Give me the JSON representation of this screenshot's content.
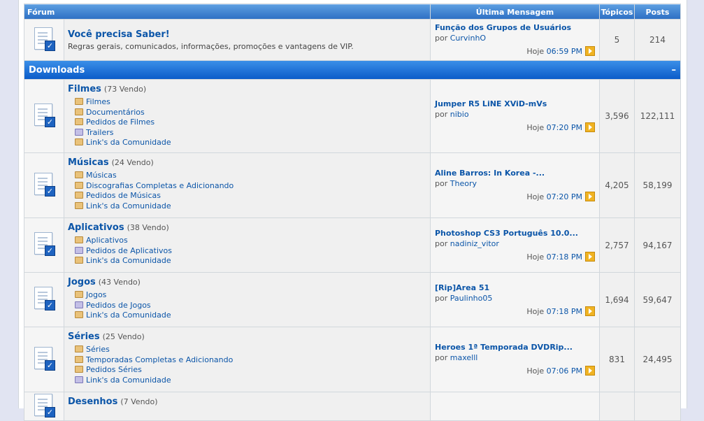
{
  "header": {
    "forum": "Fórum",
    "last_post": "Última Mensagem",
    "threads": "Tópicos",
    "posts": "Posts"
  },
  "top_forum": {
    "title": "Você precisa Saber!",
    "description": "Regras gerais, comunicados, informações, promoções e vantagens de VIP.",
    "last_post": {
      "title": "Função dos Grupos de Usuários",
      "by": "por",
      "user": "CurvinhO",
      "day": "Hoje",
      "time": "06:59 PM"
    },
    "threads": "5",
    "posts": "214"
  },
  "category": {
    "title": "Downloads",
    "collapse": "–"
  },
  "forums": [
    {
      "title": "Filmes",
      "viewing": "(73 Vendo)",
      "subforums": [
        {
          "label": "Filmes",
          "icon": "folder-icon"
        },
        {
          "label": "Documentários",
          "icon": "folder-icon"
        },
        {
          "label": "Pedidos de Filmes",
          "icon": "folder-icon"
        },
        {
          "label": "Trailers",
          "icon": "folder-purple-icon"
        },
        {
          "label": "Link's da Comunidade",
          "icon": "folder-icon"
        }
      ],
      "last_post": {
        "title": "Jumper R5 LiNE XViD-mVs",
        "by": "por",
        "user": "nibio",
        "day": "Hoje",
        "time": "07:20 PM"
      },
      "threads": "3,596",
      "posts": "122,111"
    },
    {
      "title": "Músicas",
      "viewing": "(24 Vendo)",
      "subforums": [
        {
          "label": "Músicas",
          "icon": "folder-icon"
        },
        {
          "label": "Discografias Completas e Adicionando",
          "icon": "folder-icon"
        },
        {
          "label": "Pedidos de Músicas",
          "icon": "folder-icon"
        },
        {
          "label": "Link's da Comunidade",
          "icon": "folder-icon"
        }
      ],
      "last_post": {
        "title": "Aline Barros: In Korea -...",
        "by": "por",
        "user": "Theory",
        "day": "Hoje",
        "time": "07:20 PM"
      },
      "threads": "4,205",
      "posts": "58,199"
    },
    {
      "title": "Aplicativos",
      "viewing": "(38 Vendo)",
      "subforums": [
        {
          "label": "Aplicativos",
          "icon": "folder-icon"
        },
        {
          "label": "Pedidos de Aplicativos",
          "icon": "folder-purple-icon"
        },
        {
          "label": "Link's da Comunidade",
          "icon": "folder-icon"
        }
      ],
      "last_post": {
        "title": "Photoshop CS3 Português 10.0...",
        "by": "por",
        "user": "nadiniz_vitor",
        "day": "Hoje",
        "time": "07:18 PM"
      },
      "threads": "2,757",
      "posts": "94,167"
    },
    {
      "title": "Jogos",
      "viewing": "(43 Vendo)",
      "subforums": [
        {
          "label": "Jogos",
          "icon": "folder-icon"
        },
        {
          "label": "Pedidos de Jogos",
          "icon": "folder-purple-icon"
        },
        {
          "label": "Link's da Comunidade",
          "icon": "folder-icon"
        }
      ],
      "last_post": {
        "title": "[Rip]Area 51",
        "by": "por",
        "user": "Paulinho05",
        "day": "Hoje",
        "time": "07:18 PM"
      },
      "threads": "1,694",
      "posts": "59,647"
    },
    {
      "title": "Séries",
      "viewing": "(25 Vendo)",
      "subforums": [
        {
          "label": "Séries",
          "icon": "folder-icon"
        },
        {
          "label": "Temporadas Completas e Adicionando",
          "icon": "folder-icon"
        },
        {
          "label": "Pedidos Séries",
          "icon": "folder-icon"
        },
        {
          "label": "Link's da Comunidade",
          "icon": "folder-purple-icon"
        }
      ],
      "last_post": {
        "title": "Heroes 1ª Temporada DVDRip...",
        "by": "por",
        "user": "maxelll",
        "day": "Hoje",
        "time": "07:06 PM"
      },
      "threads": "831",
      "posts": "24,495"
    },
    {
      "title": "Desenhos",
      "viewing": "(7 Vendo)",
      "subforums": [],
      "last_post": {
        "title": "",
        "by": "",
        "user": "",
        "day": "",
        "time": ""
      },
      "threads": "",
      "posts": ""
    }
  ]
}
